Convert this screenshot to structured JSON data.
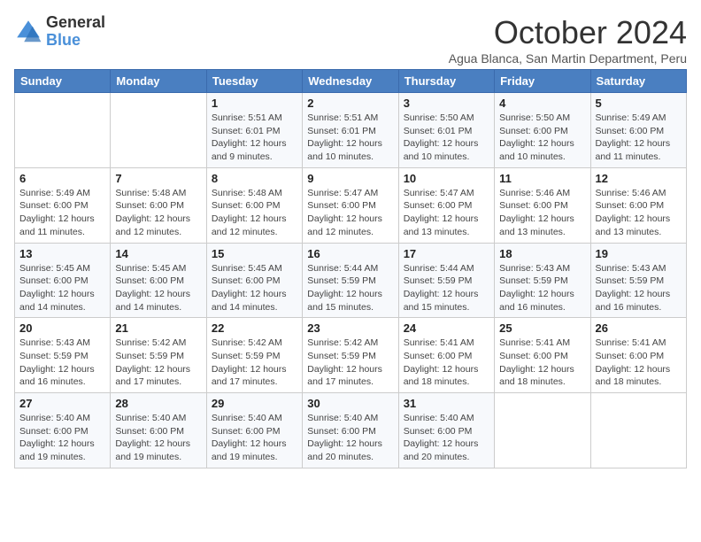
{
  "header": {
    "logo_general": "General",
    "logo_blue": "Blue",
    "title": "October 2024",
    "subtitle": "Agua Blanca, San Martin Department, Peru"
  },
  "columns": [
    "Sunday",
    "Monday",
    "Tuesday",
    "Wednesday",
    "Thursday",
    "Friday",
    "Saturday"
  ],
  "weeks": [
    [
      {
        "day": "",
        "detail": ""
      },
      {
        "day": "",
        "detail": ""
      },
      {
        "day": "1",
        "detail": "Sunrise: 5:51 AM\nSunset: 6:01 PM\nDaylight: 12 hours and 9 minutes."
      },
      {
        "day": "2",
        "detail": "Sunrise: 5:51 AM\nSunset: 6:01 PM\nDaylight: 12 hours and 10 minutes."
      },
      {
        "day": "3",
        "detail": "Sunrise: 5:50 AM\nSunset: 6:01 PM\nDaylight: 12 hours and 10 minutes."
      },
      {
        "day": "4",
        "detail": "Sunrise: 5:50 AM\nSunset: 6:00 PM\nDaylight: 12 hours and 10 minutes."
      },
      {
        "day": "5",
        "detail": "Sunrise: 5:49 AM\nSunset: 6:00 PM\nDaylight: 12 hours and 11 minutes."
      }
    ],
    [
      {
        "day": "6",
        "detail": "Sunrise: 5:49 AM\nSunset: 6:00 PM\nDaylight: 12 hours and 11 minutes."
      },
      {
        "day": "7",
        "detail": "Sunrise: 5:48 AM\nSunset: 6:00 PM\nDaylight: 12 hours and 12 minutes."
      },
      {
        "day": "8",
        "detail": "Sunrise: 5:48 AM\nSunset: 6:00 PM\nDaylight: 12 hours and 12 minutes."
      },
      {
        "day": "9",
        "detail": "Sunrise: 5:47 AM\nSunset: 6:00 PM\nDaylight: 12 hours and 12 minutes."
      },
      {
        "day": "10",
        "detail": "Sunrise: 5:47 AM\nSunset: 6:00 PM\nDaylight: 12 hours and 13 minutes."
      },
      {
        "day": "11",
        "detail": "Sunrise: 5:46 AM\nSunset: 6:00 PM\nDaylight: 12 hours and 13 minutes."
      },
      {
        "day": "12",
        "detail": "Sunrise: 5:46 AM\nSunset: 6:00 PM\nDaylight: 12 hours and 13 minutes."
      }
    ],
    [
      {
        "day": "13",
        "detail": "Sunrise: 5:45 AM\nSunset: 6:00 PM\nDaylight: 12 hours and 14 minutes."
      },
      {
        "day": "14",
        "detail": "Sunrise: 5:45 AM\nSunset: 6:00 PM\nDaylight: 12 hours and 14 minutes."
      },
      {
        "day": "15",
        "detail": "Sunrise: 5:45 AM\nSunset: 6:00 PM\nDaylight: 12 hours and 14 minutes."
      },
      {
        "day": "16",
        "detail": "Sunrise: 5:44 AM\nSunset: 5:59 PM\nDaylight: 12 hours and 15 minutes."
      },
      {
        "day": "17",
        "detail": "Sunrise: 5:44 AM\nSunset: 5:59 PM\nDaylight: 12 hours and 15 minutes."
      },
      {
        "day": "18",
        "detail": "Sunrise: 5:43 AM\nSunset: 5:59 PM\nDaylight: 12 hours and 16 minutes."
      },
      {
        "day": "19",
        "detail": "Sunrise: 5:43 AM\nSunset: 5:59 PM\nDaylight: 12 hours and 16 minutes."
      }
    ],
    [
      {
        "day": "20",
        "detail": "Sunrise: 5:43 AM\nSunset: 5:59 PM\nDaylight: 12 hours and 16 minutes."
      },
      {
        "day": "21",
        "detail": "Sunrise: 5:42 AM\nSunset: 5:59 PM\nDaylight: 12 hours and 17 minutes."
      },
      {
        "day": "22",
        "detail": "Sunrise: 5:42 AM\nSunset: 5:59 PM\nDaylight: 12 hours and 17 minutes."
      },
      {
        "day": "23",
        "detail": "Sunrise: 5:42 AM\nSunset: 5:59 PM\nDaylight: 12 hours and 17 minutes."
      },
      {
        "day": "24",
        "detail": "Sunrise: 5:41 AM\nSunset: 6:00 PM\nDaylight: 12 hours and 18 minutes."
      },
      {
        "day": "25",
        "detail": "Sunrise: 5:41 AM\nSunset: 6:00 PM\nDaylight: 12 hours and 18 minutes."
      },
      {
        "day": "26",
        "detail": "Sunrise: 5:41 AM\nSunset: 6:00 PM\nDaylight: 12 hours and 18 minutes."
      }
    ],
    [
      {
        "day": "27",
        "detail": "Sunrise: 5:40 AM\nSunset: 6:00 PM\nDaylight: 12 hours and 19 minutes."
      },
      {
        "day": "28",
        "detail": "Sunrise: 5:40 AM\nSunset: 6:00 PM\nDaylight: 12 hours and 19 minutes."
      },
      {
        "day": "29",
        "detail": "Sunrise: 5:40 AM\nSunset: 6:00 PM\nDaylight: 12 hours and 19 minutes."
      },
      {
        "day": "30",
        "detail": "Sunrise: 5:40 AM\nSunset: 6:00 PM\nDaylight: 12 hours and 20 minutes."
      },
      {
        "day": "31",
        "detail": "Sunrise: 5:40 AM\nSunset: 6:00 PM\nDaylight: 12 hours and 20 minutes."
      },
      {
        "day": "",
        "detail": ""
      },
      {
        "day": "",
        "detail": ""
      }
    ]
  ]
}
